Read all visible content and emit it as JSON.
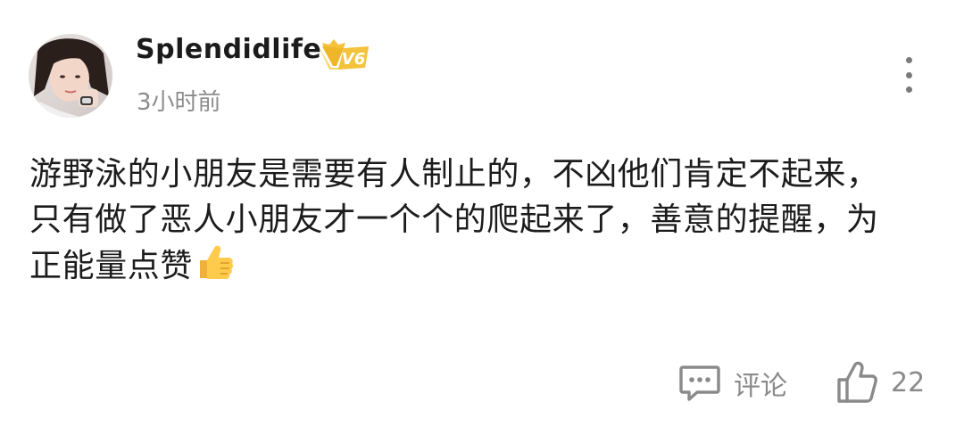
{
  "comment": {
    "author": {
      "name": "Splendidlife",
      "badge": "V6",
      "badge_color": "#f5c33b"
    },
    "time": "3小时前",
    "text_lines": [
      "游野泳的小朋友是需要有人制止的，不凶他们肯定不起来，",
      "只有做了恶人小朋友才一个个的爬起来了，善意的提醒，为",
      "正能量点赞"
    ],
    "emoji": "thumbs-up",
    "actions": {
      "reply_label": "评论",
      "like_count": "22"
    }
  },
  "icons": {
    "more": "more-vertical-icon",
    "reply": "comment-bubble-icon",
    "like": "thumbs-up-outline-icon"
  }
}
